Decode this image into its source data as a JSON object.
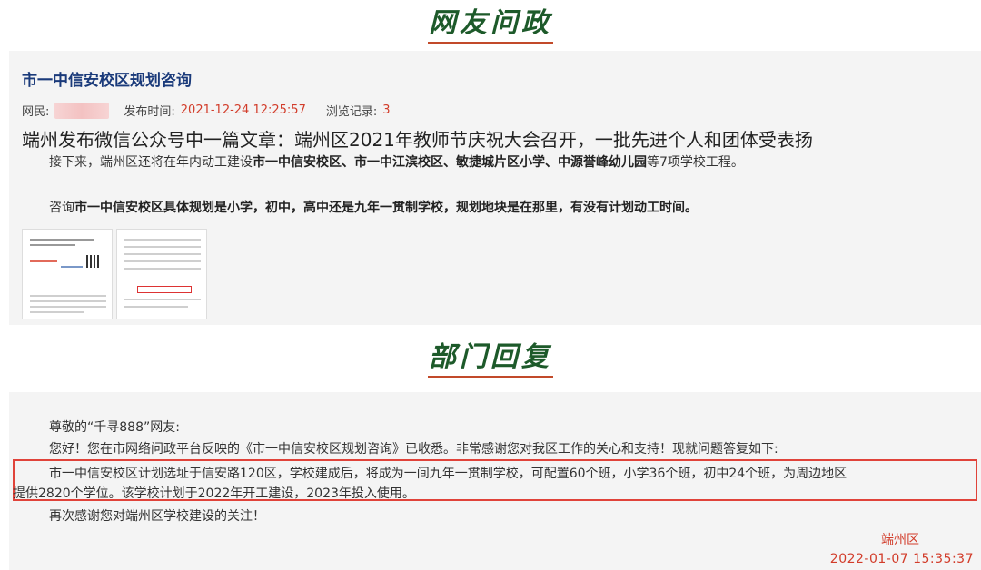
{
  "sections": {
    "question_heading": "网友问政",
    "reply_heading": "部门回复"
  },
  "question": {
    "title": "市一中信安校区规划咨询",
    "meta": {
      "netizen_label": "网民:",
      "post_time_label": "发布时间:",
      "post_time": "2021-12-24 12:25:57",
      "views_label": "浏览记录:",
      "views": "3"
    },
    "headline": "端州发布微信公众号中一篇文章：端州区2021年教师节庆祝大会召开，一批先进个人和团体受表扬",
    "para1": {
      "lead": "接下来，端州区还将在年内动工建设",
      "bold": "市一中信安校区、市一中江滨校区、敏捷城片区小学、中源誉峰幼儿园",
      "tail": "等7项学校工程。"
    },
    "para2": {
      "lead": "咨询",
      "bold": "市一中信安校区具体规划是小学，初中，高中还是九年一贯制学校，规划地块是在那里，有没有计划动工时间。"
    }
  },
  "reply": {
    "greeting": "尊敬的“千寻888”网友:",
    "intro": "您好！您在市网络问政平台反映的《市一中信安校区规划咨询》已收悉。非常感谢您对我区工作的关心和支持！现就问题答复如下:",
    "body_line1": "市一中信安校区计划选址于信安路120区，学校建成后，将成为一间九年一贯制学校，可配置60个班，小学36个班，初中24个班，为周边地区",
    "body_line2": "提供2820个学位。该学校计划于2022年开工建设，2023年投入使用。",
    "thanks": "再次感谢您对端州区学校建设的关注！",
    "signature": "端州区",
    "date": "2022-01-07 15:35:37"
  },
  "colors": {
    "heading_green": "#1d5a2a",
    "title_blue": "#1a3a7a",
    "accent_red": "#d23c2a",
    "highlight_border": "#e0433a"
  }
}
